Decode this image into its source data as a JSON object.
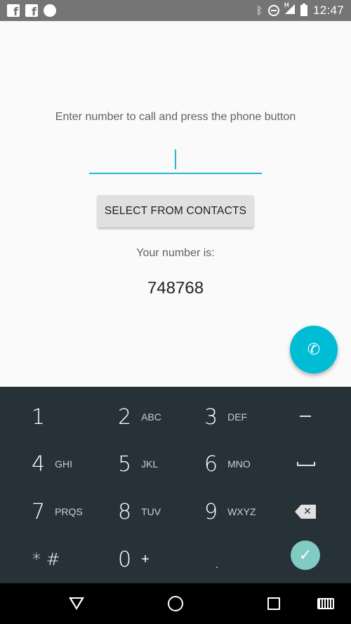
{
  "status_bar": {
    "notification_icons": [
      "facebook-icon",
      "facebook-icon",
      "chat-icon"
    ],
    "network_label": "H",
    "time": "12:47"
  },
  "main": {
    "instruction": "Enter number to call and press the phone button",
    "input": {
      "value": "",
      "placeholder": ""
    },
    "select_button_label": "SELECT FROM CONTACTS",
    "your_number_label": "Your number is:",
    "your_number": "748768",
    "fab_icon": "phone-icon"
  },
  "keypad": {
    "keys": [
      {
        "digit": "1",
        "letters": ""
      },
      {
        "digit": "2",
        "letters": "ABC"
      },
      {
        "digit": "3",
        "letters": "DEF"
      },
      {
        "digit": "4",
        "letters": "GHI"
      },
      {
        "digit": "5",
        "letters": "JKL"
      },
      {
        "digit": "6",
        "letters": "MNO"
      },
      {
        "digit": "7",
        "letters": "PRQS"
      },
      {
        "digit": "8",
        "letters": "TUV"
      },
      {
        "digit": "9",
        "letters": "WXYZ"
      },
      {
        "digit": "* #",
        "letters": ""
      },
      {
        "digit": "0",
        "letters": "+"
      },
      {
        "digit": ".",
        "letters": ""
      }
    ],
    "special": [
      "dash-icon",
      "space-icon",
      "backspace-icon",
      "done-icon"
    ],
    "background": "#263238"
  },
  "colors": {
    "accent": "#00bcd4",
    "status_bar": "#757575",
    "done": "#80cbc4"
  },
  "nav_bar": {
    "icons": [
      "back-icon",
      "home-icon",
      "recents-icon",
      "keyboard-icon"
    ]
  }
}
